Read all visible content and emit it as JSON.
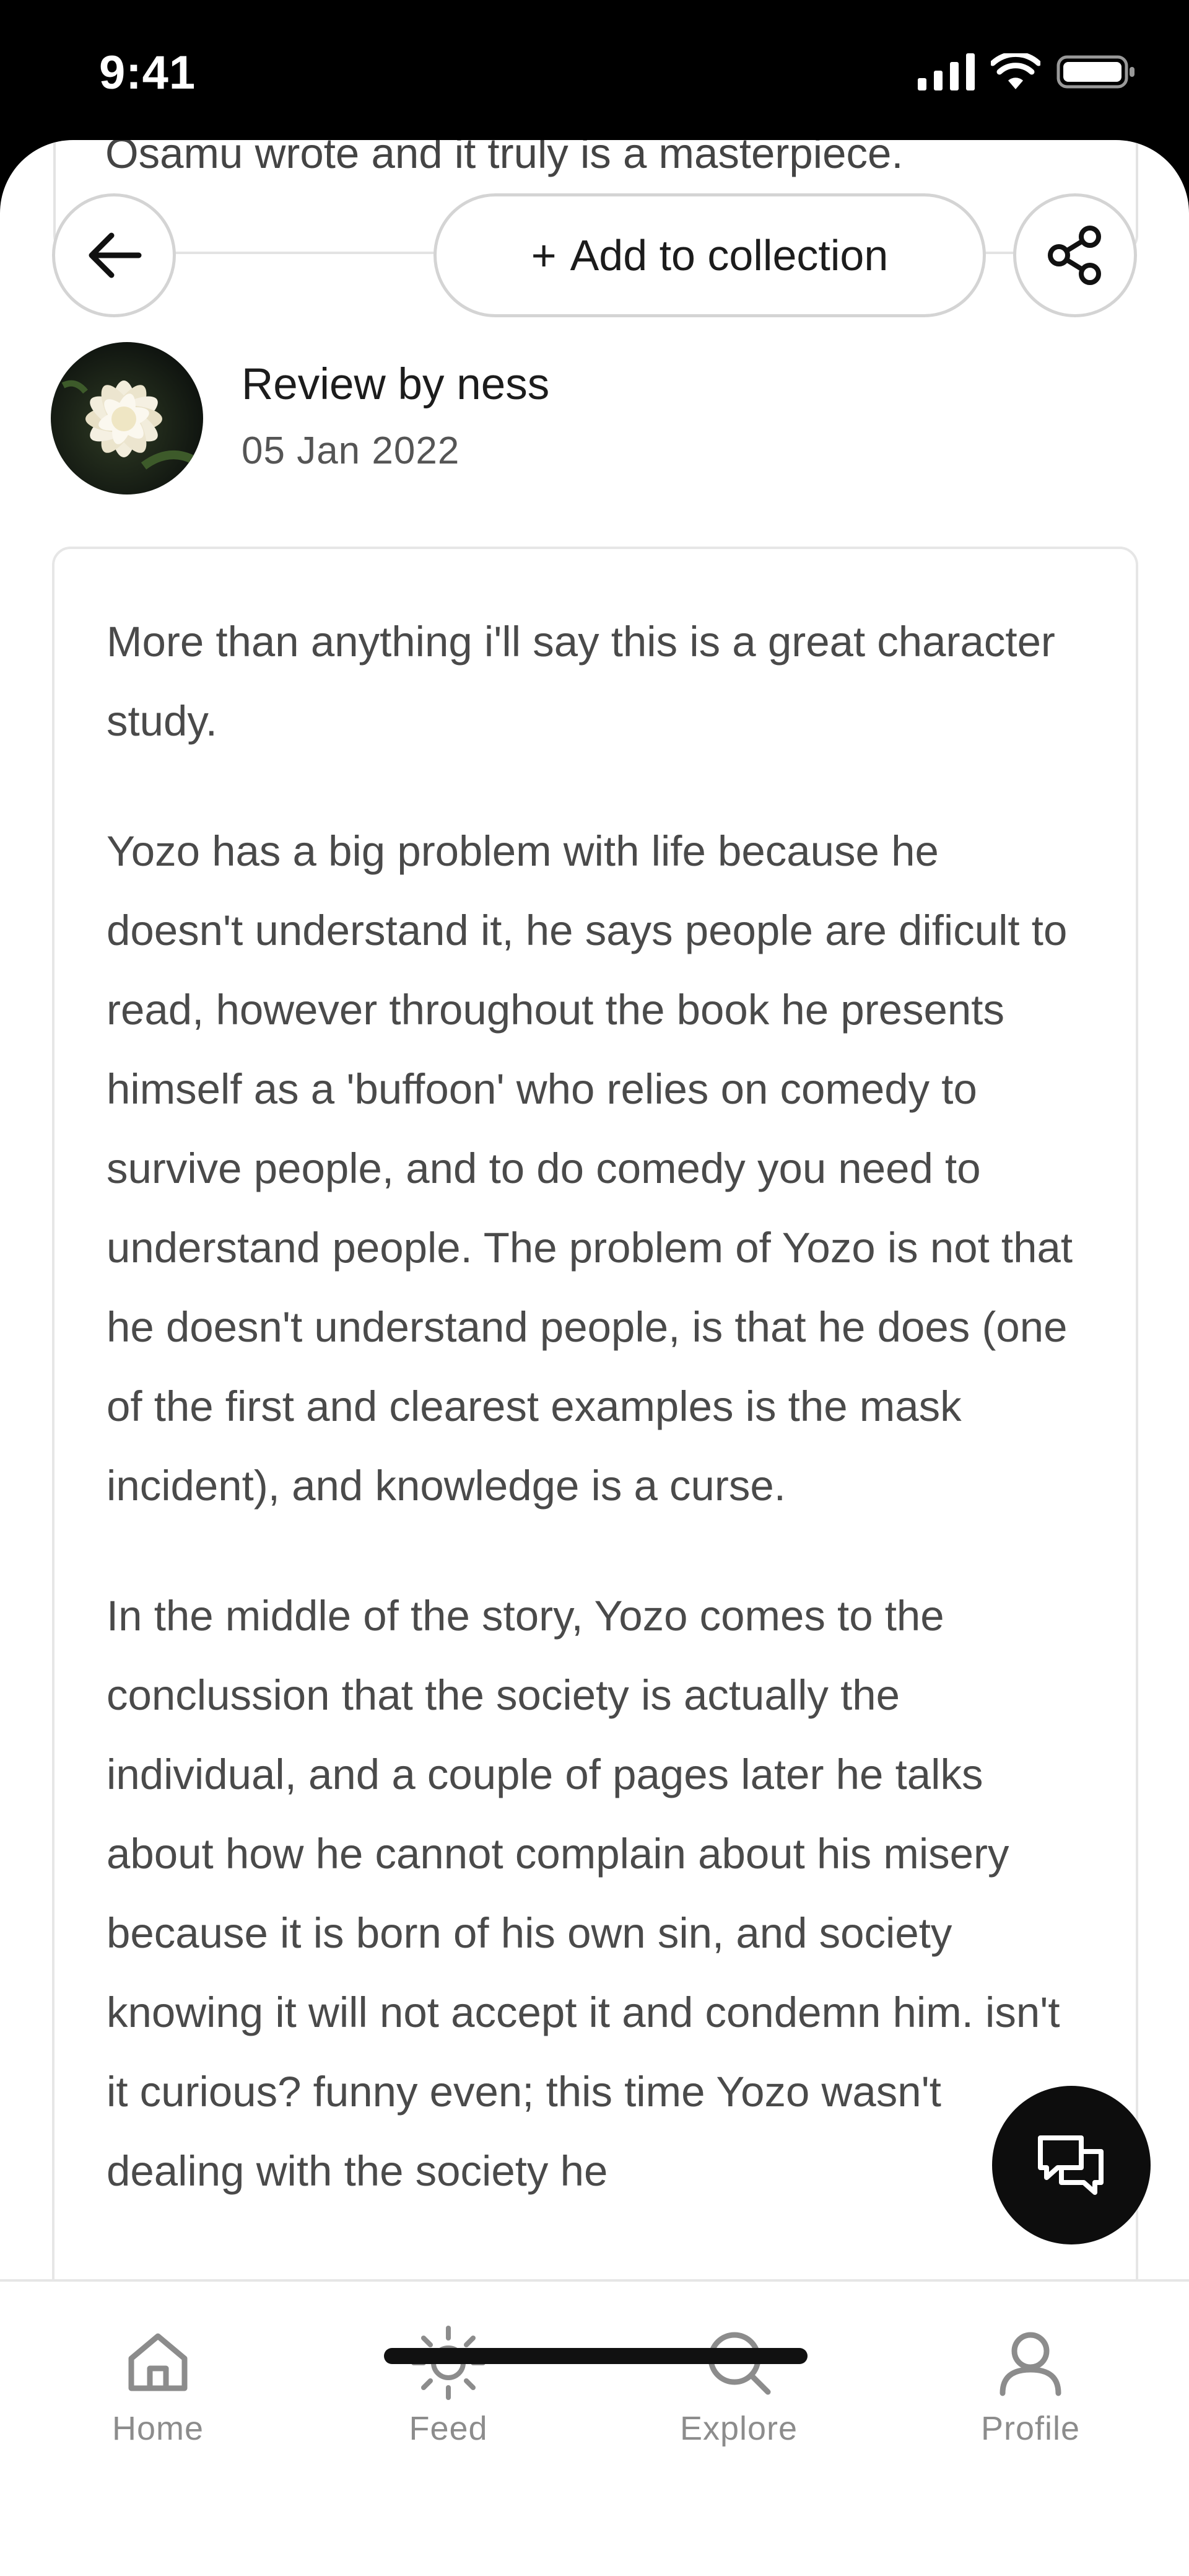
{
  "status_bar": {
    "time": "9:41",
    "icons": [
      "signal-icon",
      "wifi-icon",
      "battery-icon"
    ]
  },
  "previous_text": "Osamu wrote and it truly is a masterpiece.",
  "toolbar": {
    "add_to_collection_plus": "+",
    "add_to_collection_label": "Add to collection"
  },
  "review": {
    "title": "Review by ness",
    "date": "05 Jan 2022",
    "paragraphs": [
      "More than anything i'll say this is a great character study.",
      "Yozo has a big problem with life because he doesn't understand it, he says people are dificult to read, however throughout the book he presents himself as a 'buffoon' who relies on comedy to survive people, and to do comedy you need to understand people. The problem of Yozo is not that he doesn't understand people, is that he does (one of the first and clearest examples is the mask incident), and knowledge is a curse.",
      "In the middle of the story, Yozo comes to the conclussion that the society is actually the individual, and a couple of pages later he talks about how he cannot complain about his misery because it is born of his own sin, and society knowing it will not accept it and condemn him. isn't it curious? funny even; this time Yozo wasn't dealing with the society he"
    ]
  },
  "nav": {
    "items": [
      {
        "label": "Home",
        "icon": "home-icon"
      },
      {
        "label": "Feed",
        "icon": "sun-icon"
      },
      {
        "label": "Explore",
        "icon": "search-icon"
      },
      {
        "label": "Profile",
        "icon": "profile-icon"
      }
    ]
  },
  "colors": {
    "background": "#ffffff",
    "text": "#4a4a4a",
    "muted": "#8c8c8c",
    "border": "#d4d4d4",
    "fab": "#0d0d0d"
  }
}
